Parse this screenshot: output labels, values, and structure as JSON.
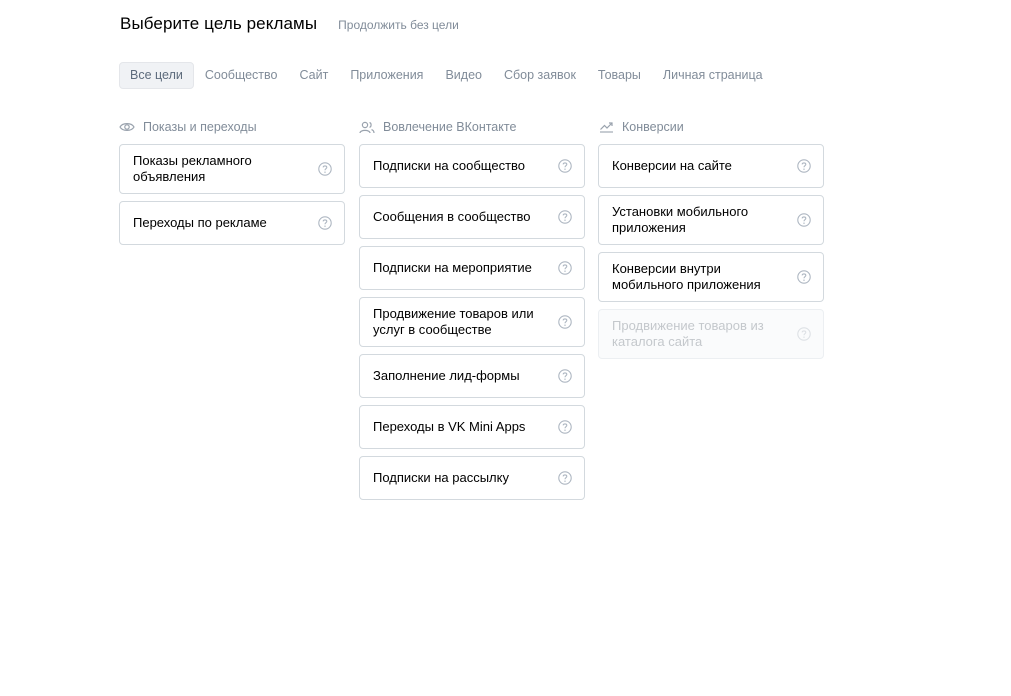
{
  "header": {
    "title": "Выберите цель рекламы",
    "skip_link": "Продолжить без цели"
  },
  "tabs": [
    {
      "label": "Все цели",
      "active": true
    },
    {
      "label": "Сообщество",
      "active": false
    },
    {
      "label": "Сайт",
      "active": false
    },
    {
      "label": "Приложения",
      "active": false
    },
    {
      "label": "Видео",
      "active": false
    },
    {
      "label": "Сбор заявок",
      "active": false
    },
    {
      "label": "Товары",
      "active": false
    },
    {
      "label": "Личная страница",
      "active": false
    }
  ],
  "columns": [
    {
      "title": "Показы и переходы",
      "icon": "eye-icon",
      "cards": [
        {
          "label": "Показы рекламного объявления",
          "disabled": false
        },
        {
          "label": "Переходы по рекламе",
          "disabled": false
        }
      ]
    },
    {
      "title": "Вовлечение ВКонтакте",
      "icon": "users-icon",
      "cards": [
        {
          "label": "Подписки на сообщество",
          "disabled": false
        },
        {
          "label": "Сообщения в сообщество",
          "disabled": false
        },
        {
          "label": "Подписки на мероприятие",
          "disabled": false
        },
        {
          "label": "Продвижение товаров или услуг в сообществе",
          "disabled": false
        },
        {
          "label": "Заполнение лид-формы",
          "disabled": false
        },
        {
          "label": "Переходы в VK Mini Apps",
          "disabled": false
        },
        {
          "label": "Подписки на рассылку",
          "disabled": false
        }
      ]
    },
    {
      "title": "Конверсии",
      "icon": "trend-icon",
      "cards": [
        {
          "label": "Конверсии на сайте",
          "disabled": false
        },
        {
          "label": "Установки мобильного приложения",
          "disabled": false
        },
        {
          "label": "Конверсии внутри мобильного приложения",
          "disabled": false
        },
        {
          "label": "Продвижение товаров из каталога сайта",
          "disabled": true
        }
      ]
    }
  ],
  "colors": {
    "muted_text": "#818c99",
    "border": "#d3d9de",
    "active_tab_bg": "#f0f2f5",
    "disabled_text": "#c4c8cc"
  }
}
